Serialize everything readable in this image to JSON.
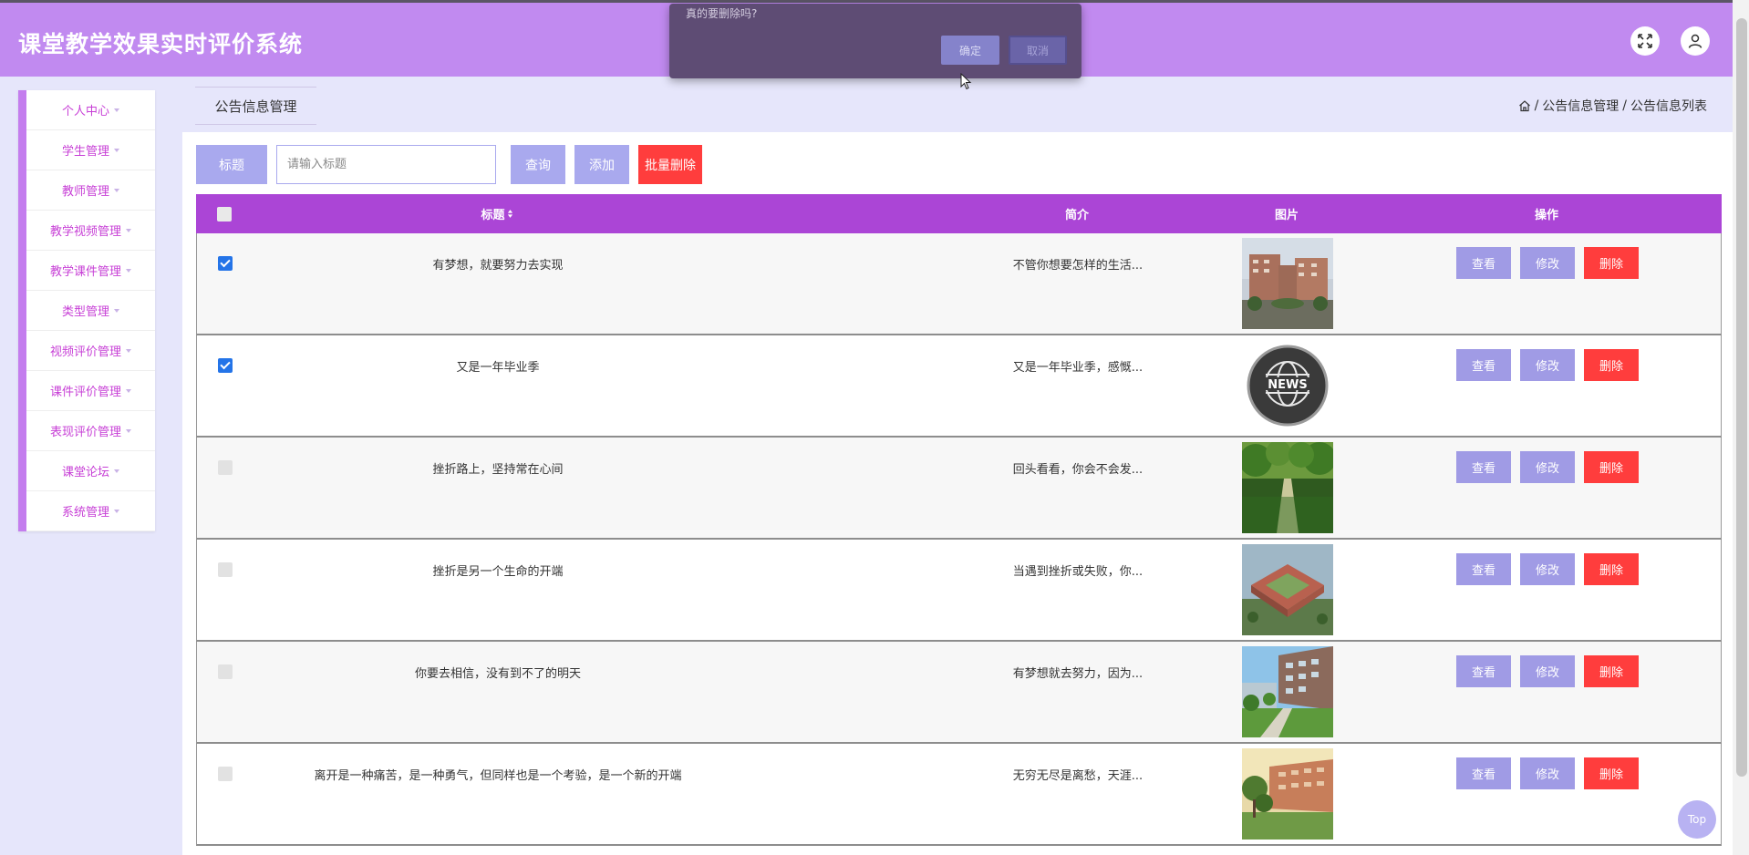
{
  "header": {
    "title": "课堂教学效果实时评价系统",
    "expand_icon": "fullscreen-icon",
    "user_icon": "user-icon"
  },
  "dialog": {
    "message": "真的要删除吗?",
    "ok_label": "确定",
    "cancel_label": "取消"
  },
  "sidebar": {
    "items": [
      {
        "label": "个人中心"
      },
      {
        "label": "学生管理"
      },
      {
        "label": "教师管理"
      },
      {
        "label": "教学视频管理"
      },
      {
        "label": "教学课件管理"
      },
      {
        "label": "类型管理"
      },
      {
        "label": "视频评价管理"
      },
      {
        "label": "课件评价管理"
      },
      {
        "label": "表现评价管理"
      },
      {
        "label": "课堂论坛"
      },
      {
        "label": "系统管理"
      }
    ]
  },
  "page_tab": "公告信息管理",
  "breadcrumb": {
    "home_icon": "home-icon",
    "sep": "/",
    "level1": "公告信息管理",
    "level2": "公告信息列表"
  },
  "search": {
    "label": "标题",
    "placeholder": "请输入标题",
    "query_label": "查询",
    "add_label": "添加",
    "batch_delete_label": "批量删除"
  },
  "table": {
    "headers": {
      "title": "标题",
      "summary": "简介",
      "image": "图片",
      "actions": "操作"
    },
    "rows": [
      {
        "checked": true,
        "title": "有梦想，就要努力去实现",
        "summary": "不管你想要怎样的生活...",
        "image": "campus-building-photo"
      },
      {
        "checked": true,
        "title": "又是一年毕业季",
        "summary": "又是一年毕业季，感慨...",
        "image": "news-globe-icon"
      },
      {
        "checked": false,
        "title": "挫折路上，坚持常在心间",
        "summary": "回头看看，你会不会发...",
        "image": "tree-path-photo"
      },
      {
        "checked": false,
        "title": "挫折是另一个生命的开端",
        "summary": "当遇到挫折或失败，你...",
        "image": "campus-aerial-photo"
      },
      {
        "checked": false,
        "title": "你要去相信，没有到不了的明天",
        "summary": "有梦想就去努力，因为...",
        "image": "campus-lawn-photo"
      },
      {
        "checked": false,
        "title": "离开是一种痛苦，是一种勇气，但同样也是一个考验，是一个新的开端",
        "summary": "无穷无尽是离愁，天涯...",
        "image": "campus-sunset-photo"
      }
    ],
    "view_label": "查看",
    "edit_label": "修改",
    "delete_label": "删除"
  },
  "news_label": "NEWS",
  "top_button": "Top",
  "colors": {
    "header": "#c18af0",
    "sidebar_accent": "#c47dee",
    "table_head": "#ab45d6",
    "primary_btn": "#a9a9ee",
    "danger": "#ff3d3d"
  }
}
